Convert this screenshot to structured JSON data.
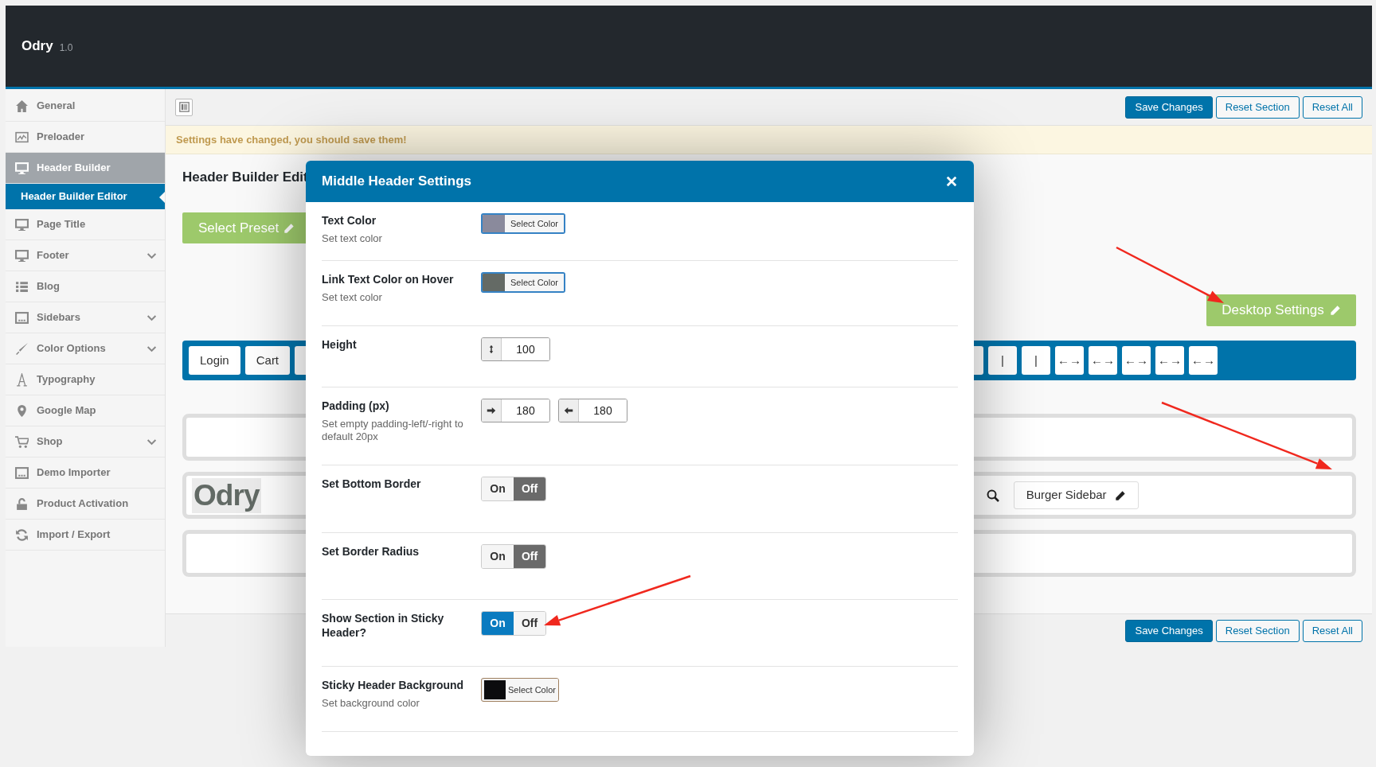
{
  "app": {
    "title": "Odry",
    "version": "1.0"
  },
  "sidebar": {
    "items": [
      {
        "label": "General",
        "selected": false,
        "collapsible": false
      },
      {
        "label": "Preloader",
        "selected": false,
        "collapsible": false
      },
      {
        "label": "Header Builder",
        "selected": true,
        "collapsible": false,
        "children": [
          {
            "label": "Header Builder Editor",
            "selected": true
          }
        ]
      },
      {
        "label": "Page Title",
        "selected": false,
        "collapsible": false
      },
      {
        "label": "Footer",
        "selected": false,
        "collapsible": true
      },
      {
        "label": "Blog",
        "selected": false,
        "collapsible": false
      },
      {
        "label": "Sidebars",
        "selected": false,
        "collapsible": true
      },
      {
        "label": "Color Options",
        "selected": false,
        "collapsible": true
      },
      {
        "label": "Typography",
        "selected": false,
        "collapsible": false
      },
      {
        "label": "Google Map",
        "selected": false,
        "collapsible": false
      },
      {
        "label": "Shop",
        "selected": false,
        "collapsible": true
      },
      {
        "label": "Demo Importer",
        "selected": false,
        "collapsible": false
      },
      {
        "label": "Product Activation",
        "selected": false,
        "collapsible": false
      },
      {
        "label": "Import / Export",
        "selected": false,
        "collapsible": false
      }
    ]
  },
  "toolbar": {
    "buttons": [
      {
        "label": "Save Changes",
        "kind": "primary"
      },
      {
        "label": "Reset Section",
        "kind": "secondary"
      },
      {
        "label": "Reset All",
        "kind": "secondary"
      }
    ]
  },
  "notice": "Settings have changed, you should save them!",
  "editor": {
    "title": "Header Builder Edit",
    "preset_button": "Select Preset",
    "desktop_button": "Desktop Settings",
    "element_bar": {
      "left_items": [
        {
          "kind": "button",
          "label": "Login"
        },
        {
          "kind": "button",
          "label": "Cart"
        },
        {
          "kind": "covered"
        }
      ],
      "right_items": [
        {
          "kind": "covered"
        },
        {
          "kind": "button",
          "label": "|"
        },
        {
          "kind": "button",
          "label": "|"
        },
        {
          "kind": "button",
          "label": "←→"
        },
        {
          "kind": "button",
          "label": "←→"
        },
        {
          "kind": "button",
          "label": "←→"
        },
        {
          "kind": "button",
          "label": "←→"
        },
        {
          "kind": "button",
          "label": "←→"
        }
      ]
    },
    "rows": [
      {
        "kind": "empty"
      },
      {
        "kind": "logo",
        "logo": "Odry",
        "items": [
          {
            "kind": "search"
          },
          {
            "kind": "button",
            "label": "Burger Sidebar"
          }
        ]
      },
      {
        "kind": "empty"
      }
    ]
  },
  "footer_bar": {
    "buttons": [
      {
        "label": "Save Changes",
        "kind": "primary"
      },
      {
        "label": "Reset Section",
        "kind": "secondary"
      },
      {
        "label": "Reset All",
        "kind": "secondary"
      }
    ]
  },
  "modal": {
    "title": "Middle Header Settings",
    "fields": [
      {
        "kind": "color",
        "label": "Text Color",
        "description": "Set text color",
        "button": "Select Color",
        "color": "#8a8a9c",
        "active": true
      },
      {
        "kind": "color",
        "label": "Link Text Color on Hover",
        "description": "Set text color",
        "button": "Select Color",
        "color": "#646a65",
        "active": true
      },
      {
        "kind": "number",
        "label": "Height",
        "inputs": [
          {
            "kind": "vertical",
            "value": "100"
          }
        ]
      },
      {
        "kind": "number",
        "label": "Padding (px)",
        "description": "Set empty padding-left/-right to default 20px",
        "inputs": [
          {
            "kind": "left",
            "value": "180"
          },
          {
            "kind": "right",
            "value": "180"
          }
        ]
      },
      {
        "kind": "toggle",
        "label": "Set Bottom Border",
        "on_label": "On",
        "off_label": "Off",
        "on": false
      },
      {
        "kind": "toggle",
        "label": "Set Border Radius",
        "on_label": "On",
        "off_label": "Off",
        "on": false
      },
      {
        "kind": "toggle",
        "label": "Show Section in Sticky Header?",
        "on_label": "On",
        "off_label": "Off",
        "on": true
      },
      {
        "kind": "color",
        "label": "Sticky Header Background",
        "description": "Set background color",
        "button": "Select Color",
        "color": "#0c0c0e",
        "active": false
      }
    ]
  }
}
